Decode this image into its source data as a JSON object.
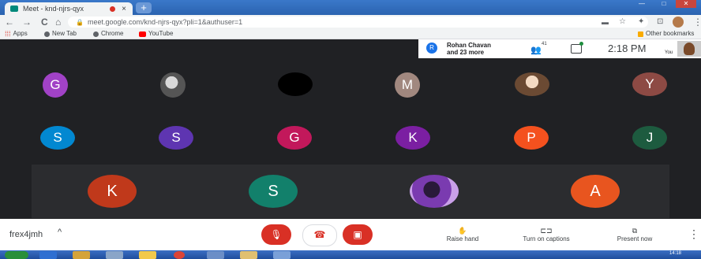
{
  "browser": {
    "tab_title": "Meet - knd-njrs-qyx",
    "tab_close": "×",
    "new_tab": "+",
    "url": "meet.google.com/knd-njrs-qyx?pli=1&authuser=1",
    "nav": {
      "back": "←",
      "forward": "→",
      "reload": "C",
      "home": "⌂"
    },
    "bookmarks": [
      {
        "label": "Apps"
      },
      {
        "label": "New Tab"
      },
      {
        "label": "Chrome"
      },
      {
        "label": "YouTube"
      }
    ],
    "other_bookmarks": "Other bookmarks"
  },
  "meet": {
    "host_initial": "R",
    "host_line1": "Rohan Chavan",
    "host_line2": "and 23 more",
    "people_count": "41",
    "clock": "2:18 PM",
    "you_label": "You",
    "participants_row1": [
      {
        "initial": "G",
        "color": "#a142c6"
      },
      {
        "initial": "",
        "photo": true
      },
      {
        "initial": "",
        "color": "#000000"
      },
      {
        "initial": "M",
        "color": "#a1887f"
      },
      {
        "initial": "",
        "photo": true
      },
      {
        "initial": "Y",
        "color": "#8d4a44"
      }
    ],
    "participants_row2": [
      {
        "initial": "S",
        "color": "#0288d1"
      },
      {
        "initial": "S",
        "color": "#5e35b1"
      },
      {
        "initial": "G",
        "color": "#c2185b"
      },
      {
        "initial": "K",
        "color": "#7b1fa2"
      },
      {
        "initial": "P",
        "color": "#f4511e"
      },
      {
        "initial": "J",
        "color": "#1d5b3f"
      }
    ],
    "participants_row3": [
      {
        "initial": "K",
        "color": "#c0391b"
      },
      {
        "initial": "S",
        "color": "#12806b"
      },
      {
        "initial": "",
        "photo": true
      },
      {
        "initial": "A",
        "color": "#e8551f"
      }
    ],
    "meeting_code": "frex4jmh",
    "caret": "^",
    "actions": {
      "raise_hand": "Raise hand",
      "captions": "Turn on captions",
      "present": "Present now"
    },
    "more": "⋮"
  },
  "taskbar": {
    "time": "14:18"
  }
}
